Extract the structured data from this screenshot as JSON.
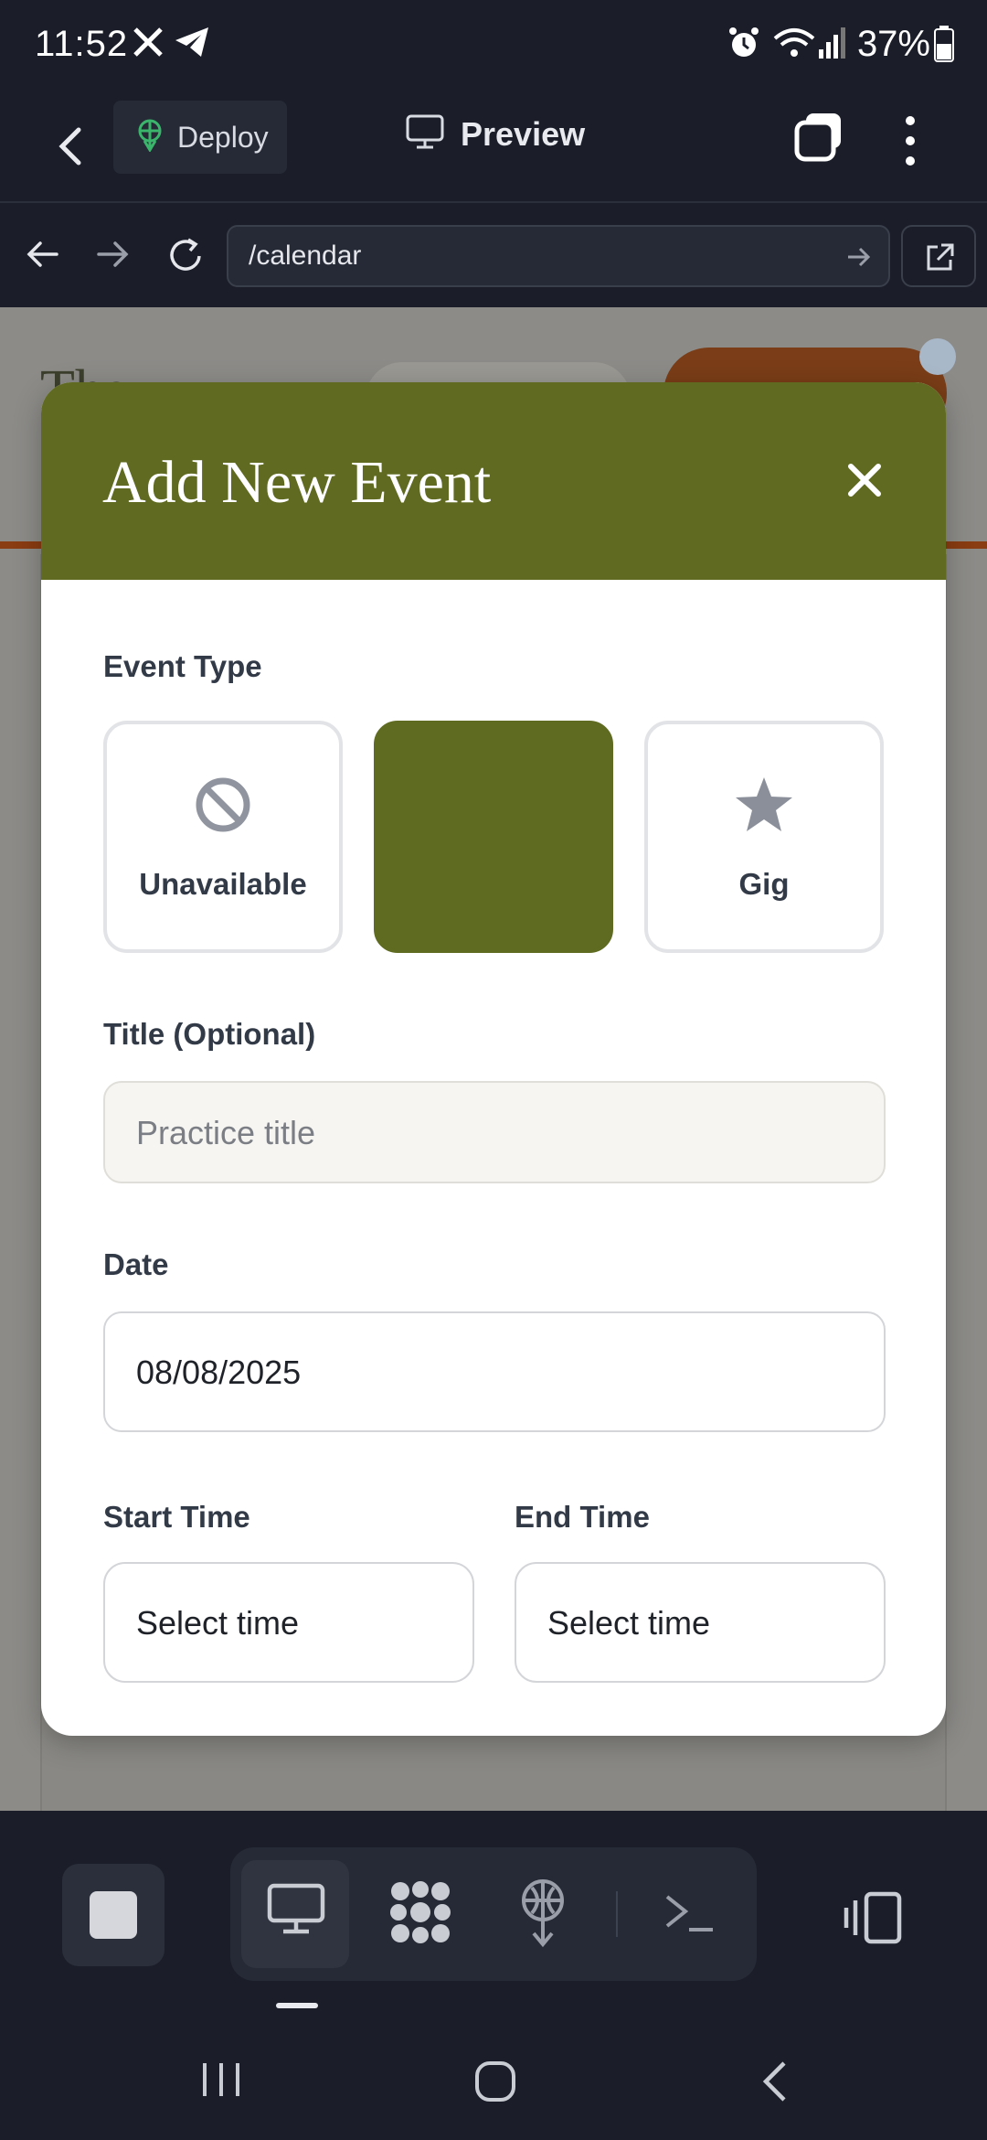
{
  "status_bar": {
    "time": "11:52",
    "battery": "37%",
    "icons": [
      "x-icon",
      "telegram-icon",
      "alarm-icon",
      "wifi-icon",
      "signal-icon",
      "battery-icon"
    ]
  },
  "app_bar": {
    "deploy_label": "Deploy",
    "preview_label": "Preview"
  },
  "url_bar": {
    "url": "/calendar"
  },
  "background_page": {
    "title_fragment": "The"
  },
  "modal": {
    "title": "Add New Event",
    "header_color": "#606a21",
    "event_type": {
      "label": "Event Type",
      "options": [
        {
          "label": "Unavailable",
          "icon": "ban-icon",
          "selected": false
        },
        {
          "label": "",
          "icon": "",
          "selected": true
        },
        {
          "label": "Gig",
          "icon": "star-icon",
          "selected": false
        }
      ]
    },
    "title_field": {
      "label": "Title (Optional)",
      "placeholder": "Practice title",
      "value": ""
    },
    "date_field": {
      "label": "Date",
      "value": "08/08/2025"
    },
    "start_time": {
      "label": "Start Time",
      "value": "Select time"
    },
    "end_time": {
      "label": "End Time",
      "value": "Select time"
    }
  },
  "toolbar": {
    "items": [
      "stop-icon",
      "desktop-icon",
      "apps-icon",
      "deploy-icon",
      "terminal-icon",
      "side-panel-icon"
    ],
    "active": "desktop-icon"
  }
}
